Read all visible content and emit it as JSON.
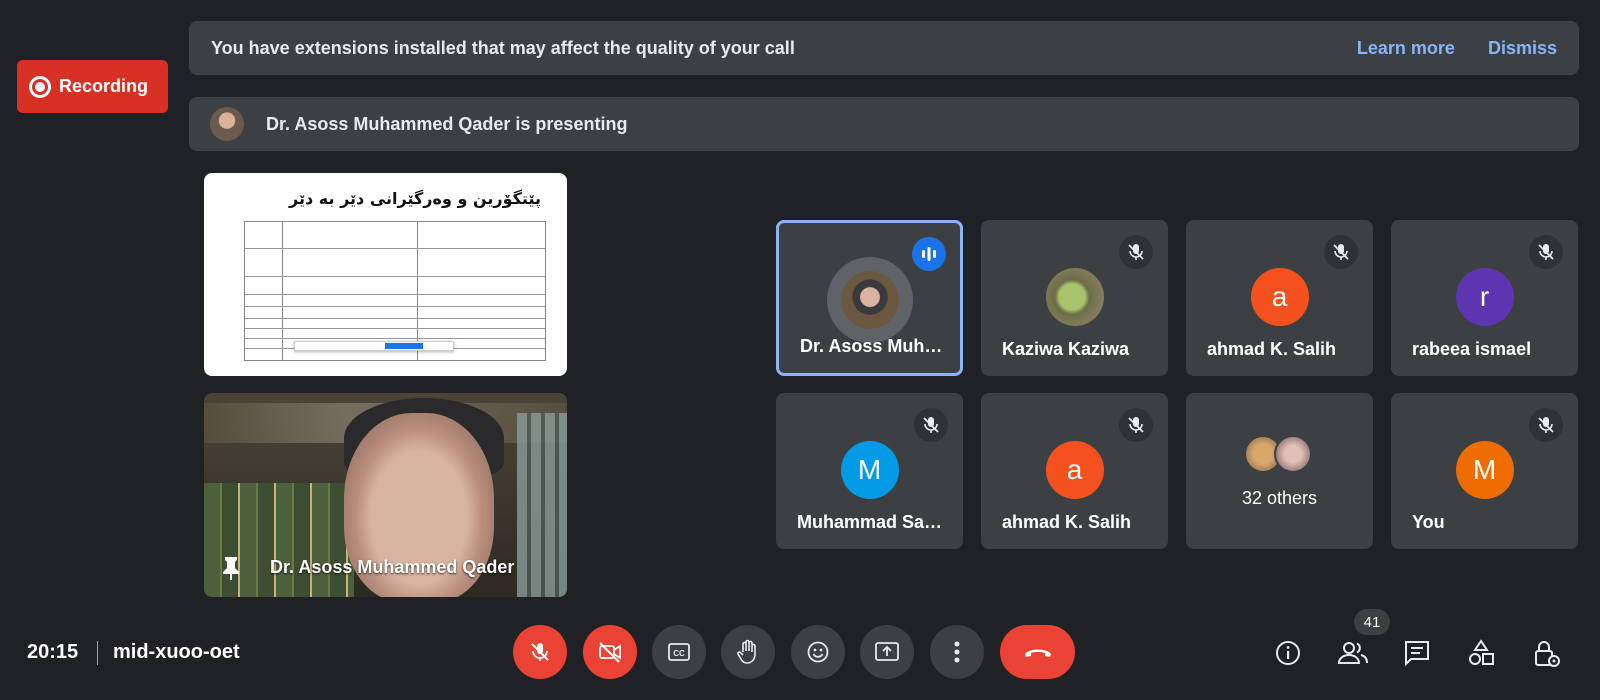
{
  "recording": {
    "label": "Recording",
    "color": "#d93025"
  },
  "extension_banner": {
    "message": "You have extensions installed that may affect the quality of your call",
    "learn_more": "Learn more",
    "dismiss": "Dismiss"
  },
  "presenting_banner": {
    "message": "Dr. Asoss Muhammed Qader is presenting"
  },
  "presentation": {
    "slide_title": "پێتگۆرین و وەرگێرانی دێر بە دێر",
    "presenter_name": "Dr. Asoss Muhammed Qader"
  },
  "participants": [
    {
      "name": "Dr. Asoss Muh…",
      "status": "speaking",
      "avatar": "photo"
    },
    {
      "name": "Kaziwa Kaziwa",
      "status": "muted",
      "avatar": "photo"
    },
    {
      "name": "ahmad K. Salih",
      "status": "muted",
      "initial": "a",
      "color": "#f4511e"
    },
    {
      "name": "rabeea ismael",
      "status": "muted",
      "initial": "r",
      "color": "#5e35b1"
    },
    {
      "name": "Muhammad Sa…",
      "status": "muted",
      "initial": "M",
      "color": "#039be5"
    },
    {
      "name": "ahmad K. Salih",
      "status": "muted",
      "initial": "a",
      "color": "#f4511e"
    },
    {
      "name": "32 others",
      "status": "group"
    },
    {
      "name": "You",
      "status": "muted",
      "initial": "M",
      "color": "#ef6c00"
    }
  ],
  "footer": {
    "time": "20:15",
    "meeting_code": "mid-xuoo-oet",
    "participant_count": "41"
  },
  "controls": [
    "mic-off-icon",
    "camera-off-icon",
    "captions-icon",
    "raise-hand-icon",
    "emoji-icon",
    "present-screen-icon",
    "more-options-icon",
    "end-call-icon"
  ],
  "right_controls": [
    "info-icon",
    "people-icon",
    "chat-icon",
    "activities-icon",
    "host-controls-icon"
  ]
}
